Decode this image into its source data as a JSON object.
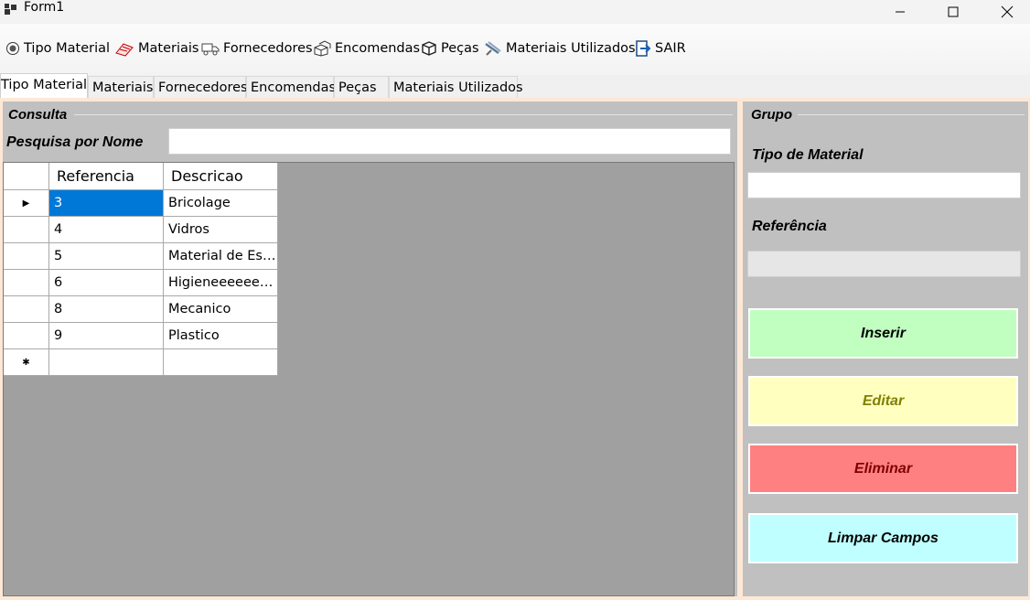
{
  "window": {
    "title": "Form1",
    "controls": {
      "minimize": "—",
      "maximize": "☐",
      "close": "✕"
    }
  },
  "menu": [
    {
      "label": "Tipo Material",
      "icon": "radio-disc-icon"
    },
    {
      "label": "Materiais",
      "icon": "materials-icon"
    },
    {
      "label": "Fornecedores",
      "icon": "truck-icon"
    },
    {
      "label": "Encomendas",
      "icon": "boxes-icon"
    },
    {
      "label": "Peças",
      "icon": "box-icon"
    },
    {
      "label": "Materiais Utilizados",
      "icon": "tools-icon"
    },
    {
      "label": "SAIR",
      "icon": "exit-icon"
    }
  ],
  "tabs": [
    "Tipo Material",
    "Materiais",
    "Fornecedores",
    "Encomendas",
    "Peças",
    "Materiais Utilizados"
  ],
  "active_tab": "Tipo Material",
  "consulta": {
    "title": "Consulta",
    "search_label": "Pesquisa por Nome",
    "search_value": "",
    "grid": {
      "columns": [
        "Referencia",
        "Descricao"
      ],
      "rows": [
        [
          "3",
          "Bricolage"
        ],
        [
          "4",
          "Vidros"
        ],
        [
          "5",
          "Material de Escr..."
        ],
        [
          "6",
          "Higieneeeeeee..."
        ],
        [
          "8",
          "Mecanico"
        ],
        [
          "9",
          "Plastico"
        ]
      ],
      "selected_row": 0,
      "current_row_marker": "▶",
      "new_row_marker": "✱"
    }
  },
  "grupo": {
    "title": "Grupo",
    "tipo_label": "Tipo de Material",
    "tipo_value": "",
    "ref_label": "Referência",
    "ref_value": "",
    "buttons": {
      "inserir": {
        "label": "Inserir",
        "bg": "#c0ffc0",
        "color": "#000000"
      },
      "editar": {
        "label": "Editar",
        "bg": "#ffffc0",
        "color": "#808000"
      },
      "eliminar": {
        "label": "Eliminar",
        "bg": "#ff8080",
        "color": "#800000"
      },
      "limpar": {
        "label": "Limpar Campos",
        "bg": "#c0ffff",
        "color": "#000000"
      }
    }
  },
  "colors": {
    "page_bg": "#fde8d6",
    "group_bg": "#c0c0c0",
    "grid_bg": "#a0a0a0",
    "selection": "#0078d7"
  }
}
